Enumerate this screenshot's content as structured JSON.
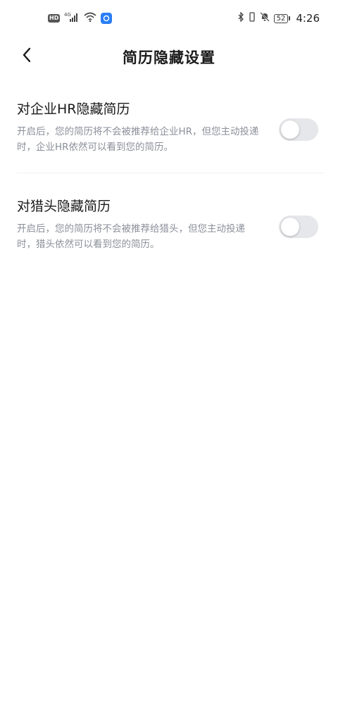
{
  "status_bar": {
    "hd_label": "HD",
    "network_label": "4G",
    "battery_level": "52",
    "time": "4:26",
    "icons": [
      "hd-icon",
      "cellular-signal-icon",
      "wifi-icon",
      "app-notification-icon",
      "bluetooth-icon",
      "vibrate-icon",
      "mute-bell-icon",
      "battery-icon"
    ]
  },
  "nav": {
    "title": "简历隐藏设置",
    "back_icon": "chevron-left-icon"
  },
  "settings": [
    {
      "title": "对企业HR隐藏简历",
      "description": "开启后，您的简历将不会被推荐给企业HR，但您主动投递时，企业HR依然可以看到您的简历。",
      "enabled": false
    },
    {
      "title": "对猎头隐藏简历",
      "description": "开启后，您的简历将不会被推荐给猎头，但您主动投递时，猎头依然可以看到您的简历。",
      "enabled": false
    }
  ],
  "colors": {
    "title_text": "#1a1a1a",
    "description_text": "#8a8f99",
    "toggle_off_track": "#e6e7ea",
    "divider": "#efefef"
  }
}
